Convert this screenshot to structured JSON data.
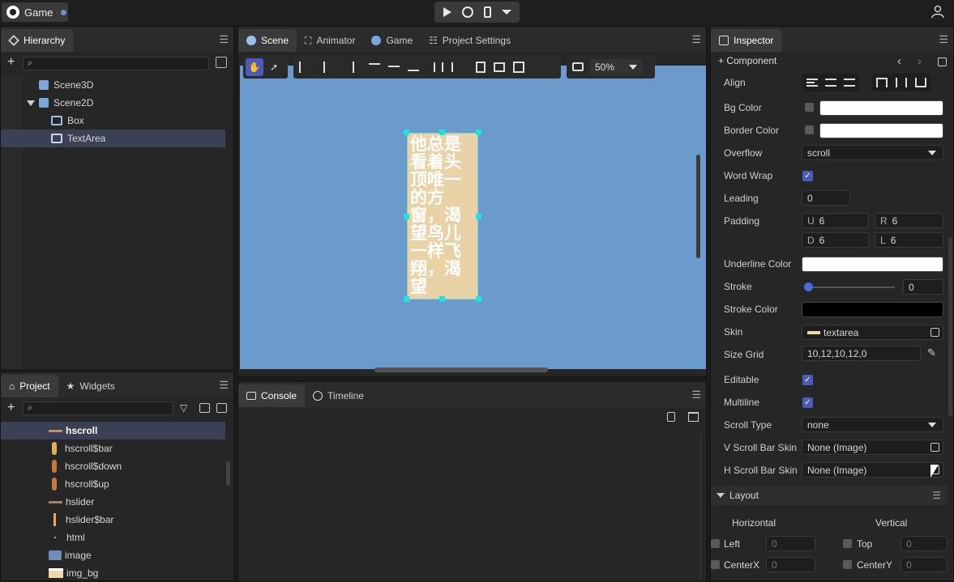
{
  "app": {
    "tab_title": "Game"
  },
  "hierarchy": {
    "title": "Hierarchy",
    "items": [
      {
        "label": "Scene3D"
      },
      {
        "label": "Scene2D"
      },
      {
        "label": "Box"
      },
      {
        "label": "TextArea"
      }
    ]
  },
  "scene": {
    "tabs": [
      {
        "label": "Scene"
      },
      {
        "label": "Animator"
      },
      {
        "label": "Game"
      },
      {
        "label": "Project Settings"
      }
    ],
    "zoom": "50%",
    "textarea_text": "他总是看着头顶唯一的方窗，渴望鸟儿一样飞翔，渴望"
  },
  "project": {
    "tabs": [
      {
        "label": "Project"
      },
      {
        "label": "Widgets"
      }
    ],
    "items": [
      {
        "label": "hscroll"
      },
      {
        "label": "hscroll$bar"
      },
      {
        "label": "hscroll$down"
      },
      {
        "label": "hscroll$up"
      },
      {
        "label": "hslider"
      },
      {
        "label": "hslider$bar"
      },
      {
        "label": "html"
      },
      {
        "label": "image"
      },
      {
        "label": "img_bg"
      }
    ]
  },
  "console": {
    "tabs": [
      {
        "label": "Console"
      },
      {
        "label": "Timeline"
      }
    ]
  },
  "inspector": {
    "title": "Inspector",
    "add_component": "+ Component",
    "props": {
      "align": "Align",
      "bg_color": "Bg Color",
      "border_color": "Border Color",
      "overflow": "Overflow",
      "overflow_value": "scroll",
      "word_wrap": "Word Wrap",
      "leading": "Leading",
      "leading_value": "0",
      "padding": "Padding",
      "pad_u": "U",
      "pad_u_val": "6",
      "pad_r": "R",
      "pad_r_val": "6",
      "pad_d": "D",
      "pad_d_val": "6",
      "pad_l": "L",
      "pad_l_val": "6",
      "underline_color": "Underline Color",
      "stroke": "Stroke",
      "stroke_value": "0",
      "stroke_color": "Stroke Color",
      "skin": "Skin",
      "skin_value": "textarea",
      "size_grid": "Size Grid",
      "size_grid_value": "10,12,10,12,0",
      "editable": "Editable",
      "multiline": "Multiline",
      "scroll_type": "Scroll Type",
      "scroll_type_value": "none",
      "v_scroll_bar_skin": "V Scroll Bar Skin",
      "v_scroll_bar_skin_value": "None (Image)",
      "h_scroll_bar_skin": "H Scroll Bar Skin",
      "h_scroll_bar_skin_value": "None (Image)"
    },
    "layout": {
      "title": "Layout",
      "horizontal": "Horizontal",
      "vertical": "Vertical",
      "left": "Left",
      "left_value": "0",
      "centerx": "CenterX",
      "centerx_value": "0",
      "top": "Top",
      "top_value": "0",
      "centery": "CenterY",
      "centery_value": "0"
    }
  },
  "colors": {
    "scene_bg": "#6b9bcd",
    "accent": "#4a5cb8",
    "textarea_bg": "#e8d2a6"
  }
}
